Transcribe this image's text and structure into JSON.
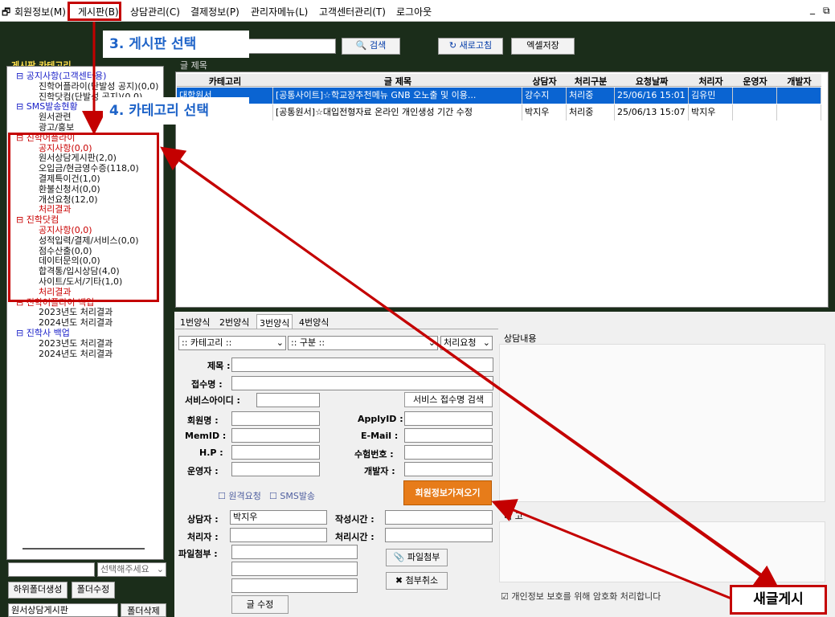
{
  "menu": {
    "items": [
      "회원정보(M)",
      "게시판(B)",
      "상담관리(C)",
      "결제정보(P)",
      "관리자메뉴(L)",
      "고객센터관리(T)",
      "로그아웃"
    ],
    "window_controls": [
      "_",
      "⧉"
    ]
  },
  "toolbar": {
    "search_label": "검색",
    "refresh_label": "새로고침",
    "excel_label": "엑셀저장"
  },
  "annotations": {
    "step3": "3. 게시판 선택",
    "step4": "4. 카테고리 선택",
    "new_post": "새글게시"
  },
  "sidebar": {
    "title": "게시판 카테고리",
    "tree": [
      {
        "text": "공지사항(고객센터용)",
        "color": "blue",
        "indent": 0
      },
      {
        "text": "진학어플라이(단발성 공지)(0,0)",
        "color": "black",
        "indent": 2
      },
      {
        "text": "진학닷컴(단발성 공지)(0,0)",
        "color": "black",
        "indent": 2
      },
      {
        "text": "SMS발송현황",
        "color": "blue",
        "indent": 0
      },
      {
        "text": "원서관련",
        "color": "black",
        "indent": 2
      },
      {
        "text": "광고/홍보",
        "color": "black",
        "indent": 2
      },
      {
        "text": "진학어플라이",
        "color": "red",
        "indent": 0
      },
      {
        "text": "공지사항(0,0)",
        "color": "red",
        "indent": 2
      },
      {
        "text": "원서상담게시판(2,0)",
        "color": "black",
        "indent": 2
      },
      {
        "text": "오입금/현금영수증(118,0)",
        "color": "black",
        "indent": 2
      },
      {
        "text": "결제특이건(1,0)",
        "color": "black",
        "indent": 2
      },
      {
        "text": "환불신청서(0,0)",
        "color": "black",
        "indent": 2
      },
      {
        "text": "개선요청(12,0)",
        "color": "black",
        "indent": 2
      },
      {
        "text": "처리결과",
        "color": "red",
        "indent": 2
      },
      {
        "text": "진학닷컴",
        "color": "red",
        "indent": 0
      },
      {
        "text": "공지사항(0,0)",
        "color": "red",
        "indent": 2
      },
      {
        "text": "성적입력/결제/서비스(0,0)",
        "color": "black",
        "indent": 2
      },
      {
        "text": "점수산출(0,0)",
        "color": "black",
        "indent": 2
      },
      {
        "text": "데이터문의(0,0)",
        "color": "black",
        "indent": 2
      },
      {
        "text": "합격통/입시상담(4,0)",
        "color": "black",
        "indent": 2
      },
      {
        "text": "사이트/도서/기타(1,0)",
        "color": "black",
        "indent": 2
      },
      {
        "text": "처리결과",
        "color": "red",
        "indent": 2
      },
      {
        "text": "진학어플라이 백업",
        "color": "red",
        "indent": 0
      },
      {
        "text": "2023년도 처리결과",
        "color": "black",
        "indent": 2
      },
      {
        "text": "2024년도 처리결과",
        "color": "black",
        "indent": 2
      },
      {
        "text": "진학사 백업",
        "color": "blue",
        "indent": 0
      },
      {
        "text": "2023년도 처리결과",
        "color": "black",
        "indent": 2
      },
      {
        "text": "2024년도 처리결과",
        "color": "black",
        "indent": 2
      }
    ],
    "select_placeholder": "선택해주세요",
    "sub_folder_btn": "하위폴더생성",
    "folder_edit_btn": "폴더수정",
    "bottom_input": "원서상담게시판",
    "folder_delete_btn": "폴더삭제"
  },
  "grid": {
    "section_label": "글 제목",
    "headers": [
      "카테고리",
      "글 제목",
      "상담자",
      "처리구분",
      "요청날짜",
      "처리자",
      "운영자",
      "개발자"
    ],
    "rows": [
      [
        "대학원서",
        "[공통사이트]☆학교장추천메뉴 GNB 오노출 및 이용...",
        "강수지",
        "처리중",
        "25/06/16 15:01",
        "김유민",
        "",
        ""
      ],
      [
        "",
        "[공통원서]☆대입전형자료 온라인 개인생성 기간 수정",
        "박지우",
        "처리중",
        "25/06/13 15:07",
        "박지우",
        "",
        ""
      ]
    ]
  },
  "form": {
    "tabs": [
      "1번양식",
      "2번양식",
      "3번양식",
      "4번양식"
    ],
    "category_select": ":: 카테고리 ::",
    "type_select": ":: 구분 ::",
    "status_select": "처리요청",
    "labels": {
      "title": "제목 :",
      "receiver": "접수명 :",
      "service_id": "서비스아이디 :",
      "member_name": "회원명 :",
      "mem_id": "MemID :",
      "hp": "H.P :",
      "operator": "운영자 :",
      "apply_id": "ApplyID :",
      "email": "E-Mail :",
      "exam_no": "수험번호 :",
      "developer": "개발자 :",
      "counselor": "상담자 :",
      "handler": "처리자 :",
      "created_time": "작성시간 :",
      "handled_time": "처리시간 :",
      "attach": "파일첨부 :"
    },
    "service_search_btn": "서비스 접수명 검색",
    "remote_request": "원격요청",
    "sms_send": "SMS발송",
    "fetch_member_btn": "회원정보가져오기",
    "counselor_value": "박지우",
    "attach_btn": "파일첨부",
    "attach_cancel_btn": "첨부취소",
    "edit_btn": "글 수정",
    "consult_label": "상담내용",
    "note_label": "비 고",
    "privacy_text": "개인정보 보호를 위해 암호화 처리합니다"
  }
}
